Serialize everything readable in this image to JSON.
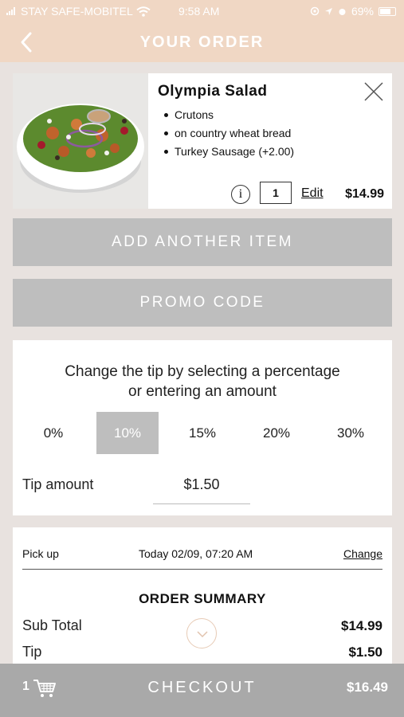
{
  "status_bar": {
    "carrier": "STAY SAFE-MOBITEL",
    "time": "9:58 AM",
    "battery": "69%"
  },
  "header": {
    "title": "YOUR ORDER",
    "back_icon": "chevron-left-icon"
  },
  "item": {
    "name": "Olympia Salad",
    "modifiers": [
      "Crutons",
      "on country wheat bread",
      "Turkey Sausage (+2.00)"
    ],
    "quantity": "1",
    "edit_label": "Edit",
    "price": "$14.99",
    "info_glyph": "i",
    "close_icon": "close-icon"
  },
  "buttons": {
    "add_item": "ADD ANOTHER ITEM",
    "promo": "PROMO CODE"
  },
  "tip": {
    "heading_line1": "Change the tip by selecting a percentage",
    "heading_line2": "or entering an amount",
    "options": [
      "0%",
      "10%",
      "15%",
      "20%",
      "30%"
    ],
    "selected": "10%",
    "amount_label": "Tip amount",
    "amount_value": "$1.50"
  },
  "summary": {
    "pickup_label": "Pick up",
    "pickup_time": "Today 02/09, 07:20 AM",
    "change_label": "Change",
    "title": "ORDER SUMMARY",
    "rows": [
      {
        "label": "Sub Total",
        "value": "$14.99"
      },
      {
        "label": "Tip",
        "value": "$1.50"
      }
    ]
  },
  "checkout": {
    "cart_count": "1",
    "label": "CHECKOUT",
    "total": "$16.49"
  },
  "colors": {
    "header_bg": "#f0d7c4",
    "page_bg": "#e8e2df",
    "button_gray": "#bebebe",
    "checkout_gray": "#a9a9a9"
  }
}
